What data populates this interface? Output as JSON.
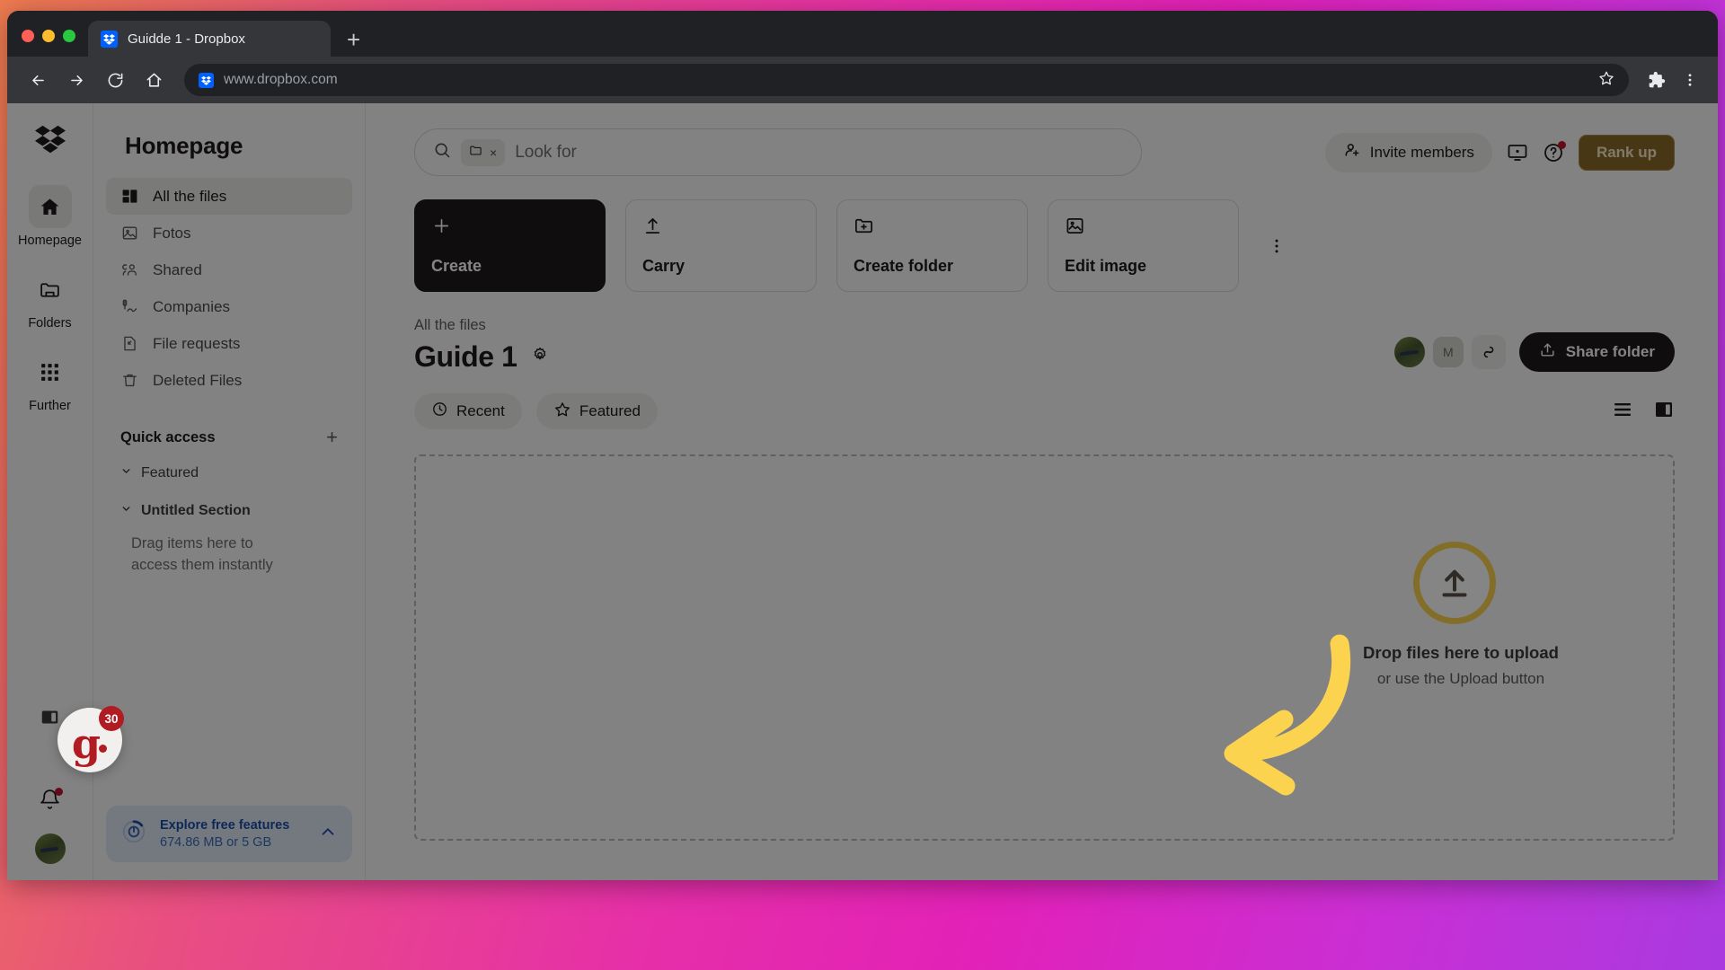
{
  "browser": {
    "tab_title": "Guidde 1 - Dropbox",
    "new_tab_label": "+",
    "url": "www.dropbox.com",
    "icons": {
      "back": "back-arrow-icon",
      "forward": "forward-arrow-icon",
      "reload": "reload-icon",
      "home": "home-icon",
      "bookmark": "star-icon",
      "extensions": "puzzle-icon",
      "menu": "three-dot-menu-icon"
    }
  },
  "rail": {
    "logo": "dropbox-logo",
    "items": [
      {
        "label": "Homepage",
        "icon": "home-icon",
        "active": true
      },
      {
        "label": "Folders",
        "icon": "folder-icon",
        "active": false
      },
      {
        "label": "Further",
        "icon": "grid-dots-icon",
        "active": false
      }
    ],
    "panel_toggle": "panel-toggle-icon",
    "bell": "bell-icon"
  },
  "sidebar": {
    "title": "Homepage",
    "nav": [
      {
        "label": "All the files",
        "icon": "files-icon",
        "active": true
      },
      {
        "label": "Fotos",
        "icon": "photo-icon",
        "active": false
      },
      {
        "label": "Shared",
        "icon": "shared-users-icon",
        "active": false
      },
      {
        "label": "Companies",
        "icon": "companies-icon",
        "active": false
      },
      {
        "label": "File requests",
        "icon": "file-request-icon",
        "active": false
      },
      {
        "label": "Deleted Files",
        "icon": "trash-icon",
        "active": false
      }
    ],
    "quick_access": {
      "title": "Quick access",
      "add_label": "+",
      "sections": [
        {
          "label": "Featured",
          "bold": false
        },
        {
          "label": "Untitled Section",
          "bold": true
        }
      ],
      "hint": "Drag items here to access them instantly"
    },
    "explore": {
      "title": "Explore free features",
      "subtitle": "674.86 MB or 5 GB",
      "icon": "storage-gauge-icon",
      "chevron": "chevron-up-icon",
      "accent": "#1a4ea8"
    }
  },
  "topbar": {
    "search": {
      "icon": "search-icon",
      "chip_icon": "folder-icon",
      "chip_clear": "×",
      "placeholder": "Look for",
      "value": ""
    },
    "invite_label": "Invite members",
    "invite_icon": "person-add-icon",
    "desktop_icon": "desktop-app-icon",
    "help_icon": "help-circle-icon",
    "rank_up_label": "Rank up",
    "rank_up_color": "#8a6a28"
  },
  "action_cards": [
    {
      "label": "Create",
      "icon": "plus-icon",
      "dark": true
    },
    {
      "label": "Carry",
      "icon": "upload-icon",
      "dark": false
    },
    {
      "label": "Create folder",
      "icon": "folder-plus-icon",
      "dark": false
    },
    {
      "label": "Edit image",
      "icon": "image-edit-icon",
      "dark": false
    }
  ],
  "cards_overflow": "three-dot-menu-icon",
  "header": {
    "breadcrumb": "All the files",
    "title": "Guide 1",
    "settings_icon": "gear-icon",
    "avatars": [
      {
        "type": "photo",
        "label": ""
      },
      {
        "type": "letter",
        "label": "M"
      }
    ],
    "link_icon": "link-icon",
    "share_label": "Share folder",
    "share_icon": "share-upload-icon"
  },
  "filters": [
    {
      "label": "Recent",
      "icon": "clock-icon"
    },
    {
      "label": "Featured",
      "icon": "star-icon"
    }
  ],
  "view_toggles": [
    {
      "name": "list-view-icon"
    },
    {
      "name": "split-panel-icon"
    }
  ],
  "dropzone": {
    "icon": "upload-circle-icon",
    "title": "Drop files here to upload",
    "subtitle": "or use the Upload button",
    "accent": "#fcd34f"
  },
  "guidde_badge": {
    "letter": "g",
    "count": "30",
    "color": "#b01c22"
  },
  "annotation": {
    "type": "curved-arrow",
    "color": "#fcd34f",
    "points_to": "upload-circle-icon"
  }
}
